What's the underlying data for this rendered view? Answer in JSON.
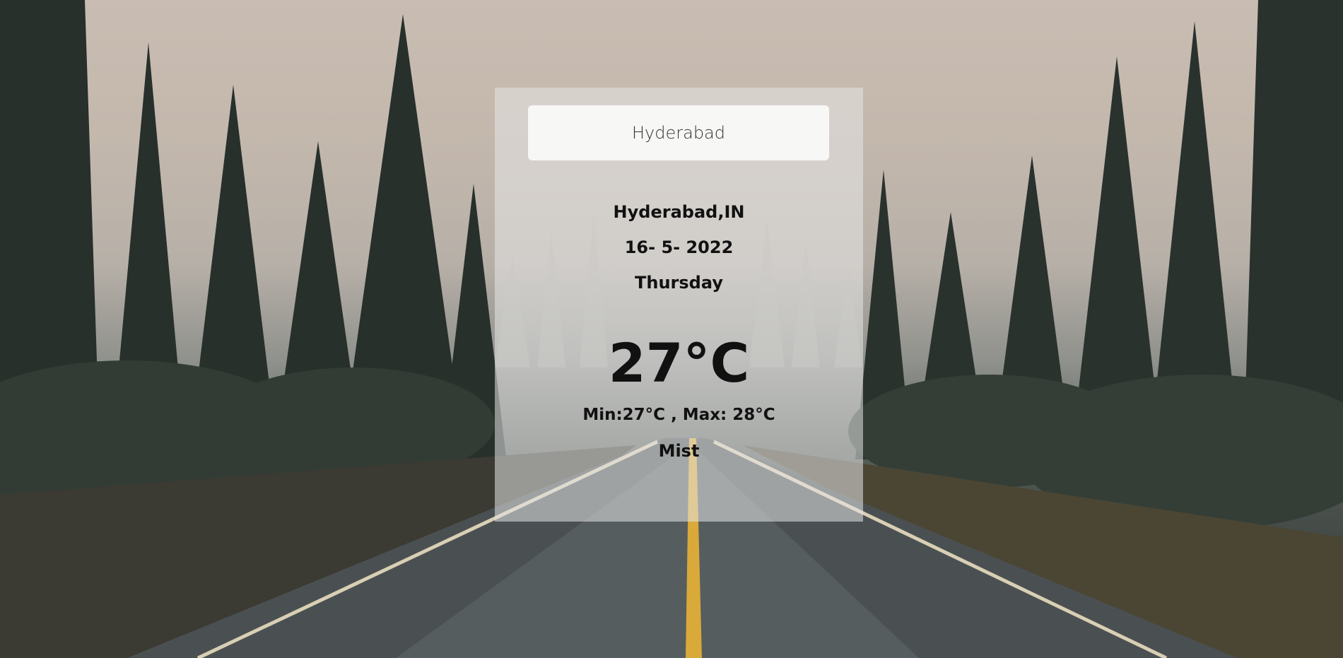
{
  "search": {
    "value": "Hyderabad"
  },
  "weather": {
    "location": "Hyderabad,IN",
    "date": "16- 5- 2022",
    "day": "Thursday",
    "temperature": "27°C",
    "min_max": "Min:27°C , Max: 28°C",
    "description": "Mist"
  }
}
